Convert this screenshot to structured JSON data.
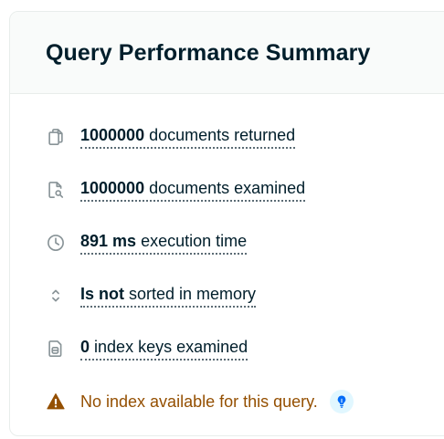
{
  "summary": {
    "title": "Query Performance Summary",
    "metrics": [
      {
        "icon": "copy-documents-icon",
        "value": "1000000",
        "label": "documents returned"
      },
      {
        "icon": "document-search-icon",
        "value": "1000000",
        "label": "documents examined"
      },
      {
        "icon": "clock-icon",
        "value": "891 ms",
        "label": "execution time"
      },
      {
        "icon": "sort-arrows-icon",
        "value": "Is not",
        "label": "sorted in memory"
      },
      {
        "icon": "index-keys-icon",
        "value": "0",
        "label": "index keys examined"
      }
    ],
    "warning": {
      "icon": "warning-triangle-icon",
      "text": "No index available for this query.",
      "hint_icon": "lightbulb-icon"
    }
  },
  "colors": {
    "title": "#001e2b",
    "icon_gray": "#889397",
    "warning_text": "#944f01",
    "warning_icon": "#944f01",
    "hint_background": "#e1f7ff",
    "hint_icon": "#016bf8"
  }
}
